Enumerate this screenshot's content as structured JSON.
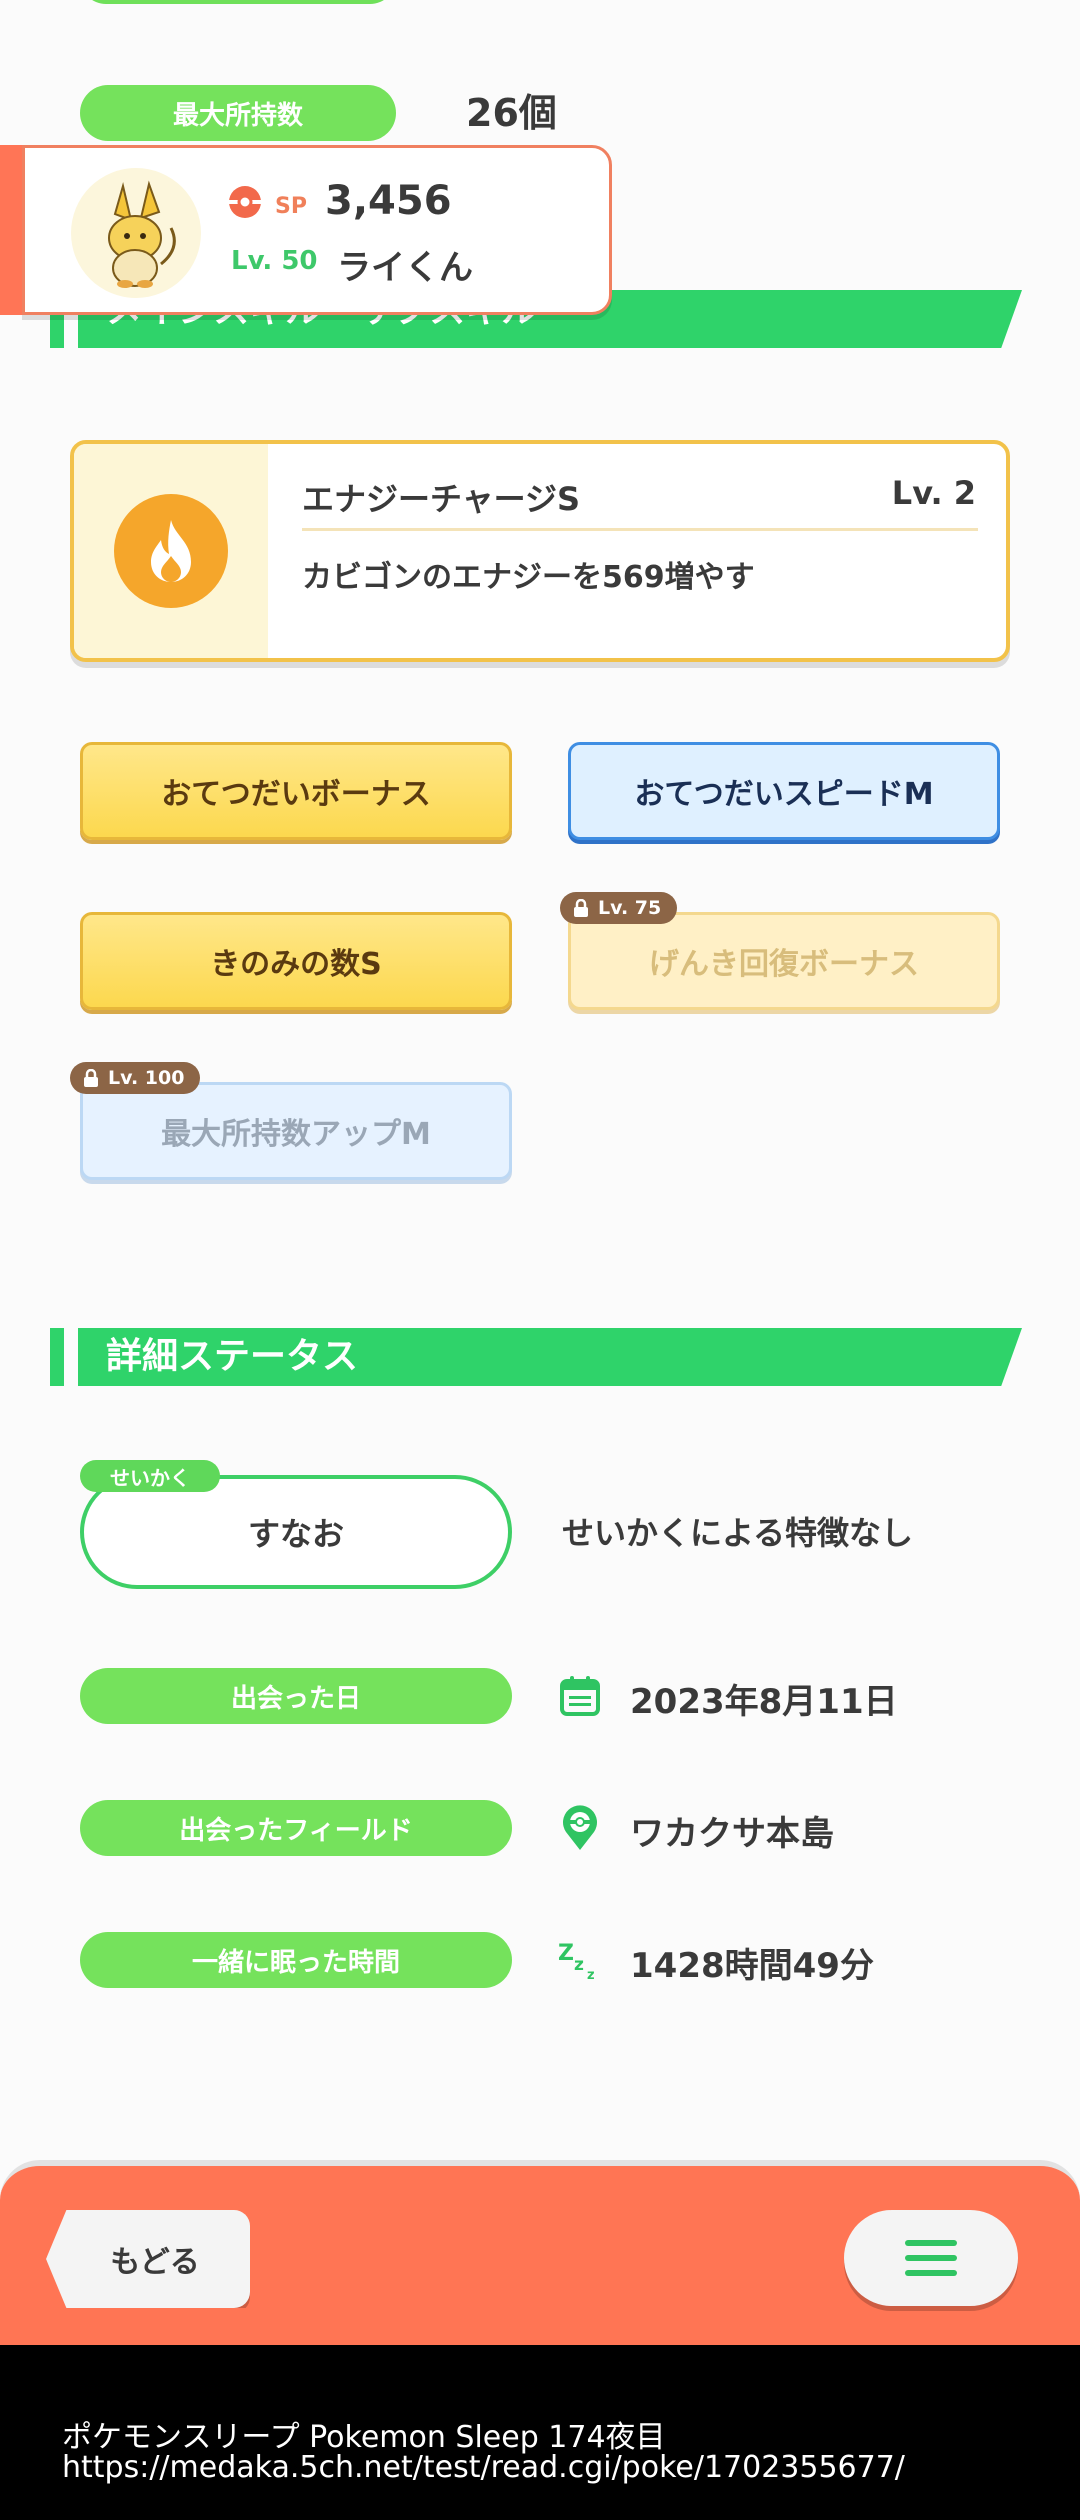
{
  "stats": {
    "max_inventory_label": "最大所持数",
    "max_inventory_value": "26個"
  },
  "pokemon": {
    "sp_label": "SP",
    "sp_value": "3,456",
    "level": "Lv. 50",
    "name": "ライくん"
  },
  "sections": {
    "skills_title": "メインスキル・サブスキル",
    "details_title": "詳細ステータス"
  },
  "main_skill": {
    "name": "エナジーチャージS",
    "level": "Lv. 2",
    "description": "カビゴンのエナジーを569増やす",
    "icon": "fire-icon",
    "color": "#f5a62b"
  },
  "sub_skills": [
    {
      "label": "おてつだいボーナス",
      "locked": false
    },
    {
      "label": "おてつだいスピードM",
      "locked": false
    },
    {
      "label": "きのみの数S",
      "locked": false
    },
    {
      "label": "げんき回復ボーナス",
      "locked": true,
      "unlock_level": "Lv. 75"
    },
    {
      "label": "最大所持数アップM",
      "locked": true,
      "unlock_level": "Lv. 100"
    }
  ],
  "nature": {
    "tag": "せいかく",
    "value": "すなお",
    "description": "せいかくによる特徴なし"
  },
  "info": [
    {
      "label": "出会った日",
      "icon": "calendar-icon",
      "value": "2023年8月11日"
    },
    {
      "label": "出会ったフィールド",
      "icon": "location-pin-icon",
      "value": "ワカクサ本島"
    },
    {
      "label": "一緒に眠った時間",
      "icon": "sleep-zzz-icon",
      "value": "1428時間49分"
    }
  ],
  "nav": {
    "back_label": "もどる",
    "menu_icon": "hamburger-menu-icon"
  },
  "footer": {
    "line1": "ポケモンスリープ Pokemon Sleep 174夜目",
    "line2": "https://medaka.5ch.net/test/read.cgi/poke/1702355677/"
  },
  "colors": {
    "accent_green": "#2fd36a",
    "pill_green": "#75e25c",
    "bottom_bar": "#ff7554"
  }
}
